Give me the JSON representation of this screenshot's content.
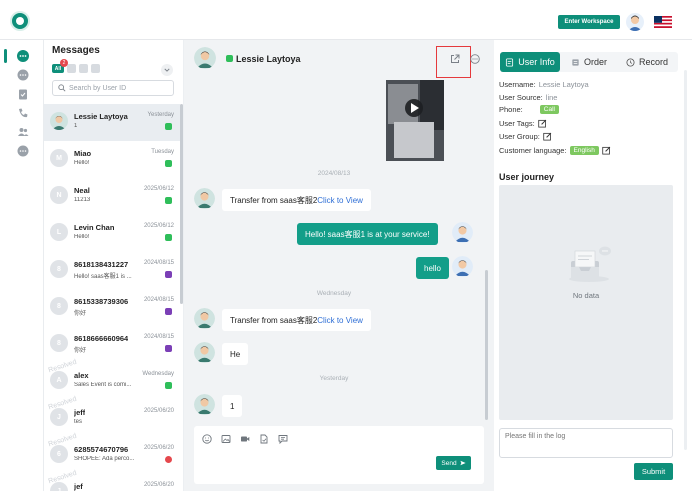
{
  "topbar": {
    "workspace_label": "Enter Workspace"
  },
  "rail": {
    "icons": [
      "chat-icon",
      "comment-icon",
      "clipboard-icon",
      "phone-icon",
      "users-icon",
      "more-icon"
    ]
  },
  "conversations": {
    "title": "Messages",
    "filter_all": "All",
    "filter_badge": "2",
    "search_placeholder": "Search by User ID",
    "items": [
      {
        "initial": "",
        "name": "Lessie Laytoya",
        "time": "Yesterday",
        "msg": "1",
        "channel": "whatsapp",
        "active": true
      },
      {
        "initial": "M",
        "name": "Miao",
        "time": "Tuesday",
        "msg": "Hello!",
        "channel": "whatsapp",
        "active": false
      },
      {
        "initial": "N",
        "name": "Neal",
        "time": "2025/06/12",
        "msg": "11213",
        "channel": "whatsapp",
        "active": false
      },
      {
        "initial": "L",
        "name": "Levin Chan",
        "time": "2025/06/12",
        "msg": "Hello!",
        "channel": "whatsapp",
        "active": false
      },
      {
        "initial": "8",
        "name": "8618138431227",
        "time": "2024/08/15",
        "msg": "Hello! saas客服1 is ...",
        "channel": "viber",
        "active": false
      },
      {
        "initial": "8",
        "name": "8615338739306",
        "time": "2024/08/15",
        "msg": "你好",
        "channel": "viber",
        "active": false
      },
      {
        "initial": "8",
        "name": "8618666660964",
        "time": "2024/08/15",
        "msg": "你好",
        "channel": "viber",
        "active": false
      },
      {
        "initial": "A",
        "name": "alex",
        "time": "Wednesday",
        "msg": "Sales Event is comi...",
        "channel": "whatsapp",
        "active": false,
        "watermark": "Resolved"
      },
      {
        "initial": "J",
        "name": "jeff",
        "time": "2025/06/20",
        "msg": "tes",
        "channel": "",
        "active": false,
        "watermark": "Resolved"
      },
      {
        "initial": "6",
        "name": "6285574670796",
        "time": "2025/06/20",
        "msg": "SHOPEE: Ada perco...",
        "channel": "red",
        "active": false,
        "watermark": "Resolved"
      },
      {
        "initial": "J",
        "name": "jef",
        "time": "2025/06/20",
        "msg": "",
        "channel": "",
        "active": false,
        "watermark": "Resolved"
      }
    ]
  },
  "chat": {
    "contact_name": "Lessie Laytoya",
    "date_1": "2024/08/13",
    "date_2": "Wednesday",
    "date_3": "Yesterday",
    "messages": {
      "transfer_1": "Transfer from saas客服2",
      "click_1": "Click to View",
      "greeting": "Hello! saas客服1 is at your service!",
      "hello": "hello",
      "transfer_2": "Transfer from saas客服2",
      "click_2": "Click to View",
      "he": "He",
      "one": "1"
    },
    "composer": {
      "send_label": "Send"
    }
  },
  "panel": {
    "tabs": {
      "user_info": "User Info",
      "order": "Order",
      "record": "Record"
    },
    "username_label": "Username:",
    "username_value": "Lessie Laytoya",
    "source_label": "User Source:",
    "source_value": "line",
    "phone_label": "Phone:",
    "phone_chip": "Call",
    "tags_label": "User Tags:",
    "group_label": "User Group:",
    "language_label": "Customer language:",
    "language_chip": "English",
    "journey_title": "User journey",
    "no_data": "No data",
    "log_placeholder": "Please fill in the log",
    "submit_label": "Submit"
  },
  "colors": {
    "accent": "#0e8f7a",
    "bubble_out": "#139e89",
    "whatsapp": "#2fbe5a",
    "viber": "#7b3fb6",
    "highlight": "#e5393c"
  }
}
